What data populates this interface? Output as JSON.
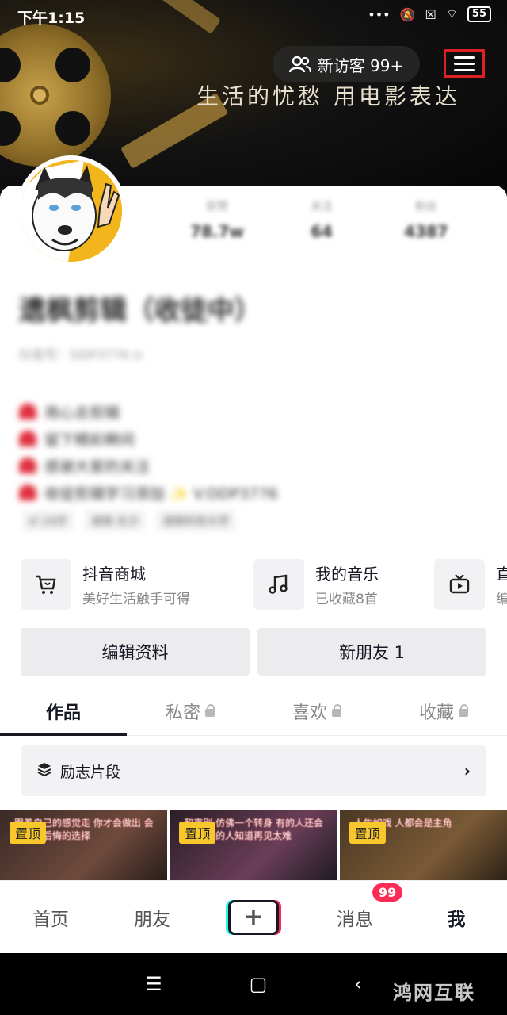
{
  "status": {
    "time": "下午1:15",
    "battery": "55"
  },
  "header": {
    "visitor_label": "新访客 99+",
    "slogan": "生活的忧愁  用电影表达"
  },
  "services": [
    {
      "title": "抖音商城",
      "subtitle": "美好生活触手可得",
      "icon": "cart-icon"
    },
    {
      "title": "我的音乐",
      "subtitle": "已收藏8首",
      "icon": "music-note-icon"
    },
    {
      "title": "直",
      "subtitle": "编",
      "icon": "tv-icon"
    }
  ],
  "buttons": {
    "edit_profile": "编辑资料",
    "new_friends": "新朋友 1"
  },
  "tabs": [
    "作品",
    "私密",
    "喜欢",
    "收藏"
  ],
  "collection": {
    "label": "励志片段"
  },
  "thumbs": [
    {
      "pin": "置顶",
      "caption": "跟着自己的感觉走 你才会做出 会让自己后悔的选择"
    },
    {
      "pin": "置顶",
      "caption": "和离别 仿佛一个转身 有的人还会回来 有的人知道再见太难"
    },
    {
      "pin": "置顶",
      "caption": "人生如戏 人都会是主角"
    }
  ],
  "bottom_nav": {
    "home": "首页",
    "friends": "朋友",
    "plus": "+",
    "messages": "消息",
    "messages_badge": "99",
    "me": "我"
  },
  "watermark": "鸿网互联"
}
